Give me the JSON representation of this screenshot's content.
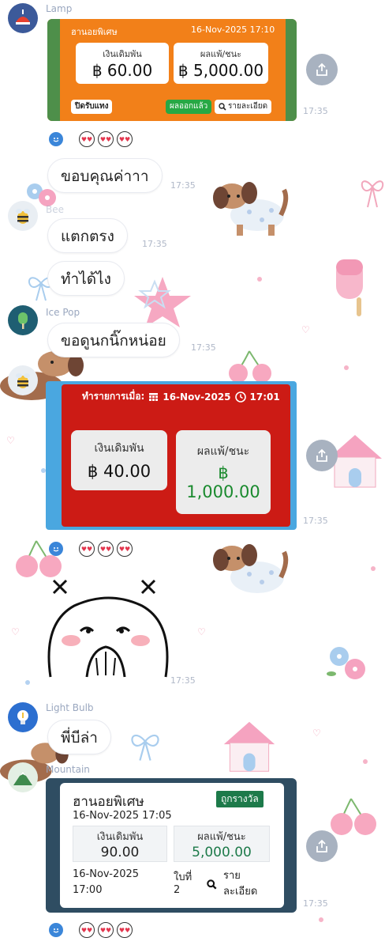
{
  "messages": {
    "m1": {
      "sender": "Lamp",
      "time": "17:35",
      "card": {
        "header_left": "ฮานอยพิเศษ",
        "header_right": "16-Nov-2025 17:10",
        "label_a": "เงินเดิมพัน",
        "value_a": "฿ 60.00",
        "label_b": "ผลแพ้/ชนะ",
        "value_b": "฿ 5,000.00",
        "btn_close": "ปิดรับแทง",
        "btn_result": "ผลออกแล้ว",
        "btn_detail": "รายละเอียด"
      }
    },
    "m2": {
      "text": "ขอบคุณค่าาา",
      "time": "17:35"
    },
    "m3": {
      "sender": "Bee",
      "text": "แตกตรง",
      "time": "17:35"
    },
    "m4": {
      "text": "ทำได้ไง"
    },
    "m5": {
      "sender": "Ice Pop",
      "text": "ขอดูนกนิ๊กหน่อย",
      "time": "17:35"
    },
    "m6": {
      "time": "17:35",
      "card": {
        "header": "ทำรายการเมื่อ:",
        "date": "16-Nov-2025",
        "clock": "17:01",
        "label_a": "เงินเดิมพัน",
        "value_a": "฿ 40.00",
        "label_b": "ผลแพ้/ชนะ",
        "value_b_symbol": "฿",
        "value_b": "1,000.00"
      }
    },
    "m7": {
      "time": "17:35"
    },
    "m8": {
      "sender": "Light Bulb",
      "text": "พี่บีล่า"
    },
    "m9": {
      "sender": "Mountain",
      "time": "17:35",
      "card": {
        "title": "ฮานอยพิเศษ",
        "badge": "ถูกรางวัล",
        "datetime": "16-Nov-2025 17:05",
        "label_a": "เงินเดิมพัน",
        "value_a": "90.00",
        "label_b": "ผลแพ้/ชนะ",
        "value_b": "5,000.00",
        "foot_date": "16-Nov-2025",
        "foot_time": "17:00",
        "foot_slip_label": "ใบที่",
        "foot_slip_no": "2",
        "foot_detail_1": "ราย",
        "foot_detail_2": "ละเอียด"
      }
    }
  },
  "icons": {
    "share": "share-icon",
    "reaction_face": "smiley-icon",
    "reaction_emoji": "heart-eyes-emoji",
    "search": "search-icon",
    "calendar": "calendar-icon",
    "clock": "clock-icon"
  },
  "colors": {
    "card1_orange": "#f28019",
    "card1_green": "#4e8f4a",
    "card2_red": "#cc1b15",
    "card2_blue": "#4aa7e0",
    "card3_navy": "#2f4d62",
    "win_green": "#1a8a2e"
  }
}
